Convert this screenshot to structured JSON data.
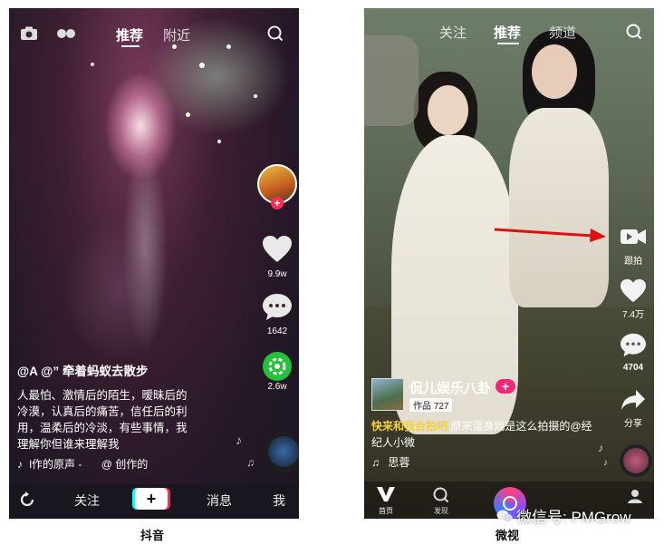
{
  "douyin": {
    "top_nav": {
      "recommend": "推荐",
      "nearby": "附近"
    },
    "side": {
      "likes": "9.9w",
      "comments": "1642",
      "shares": "2.6w"
    },
    "author_line": "@A @” 牵着蚂蚁去散步",
    "desc_lines": [
      "人最怕、激情后的陌生，暧昧后的",
      "冷漠，认真后的痛苦，信任后的利",
      "用，温柔后的冷淡，有些事情，我",
      "理解你但谁来理解我"
    ],
    "music_left": "l作的原声 -",
    "music_right": "@  创作的",
    "bottom_nav": {
      "follow": "关注",
      "plus": "+",
      "messages": "消息",
      "me": "我"
    },
    "caption": "抖音"
  },
  "weishi": {
    "top_nav": {
      "follow": "关注",
      "recommend": "推荐",
      "channel": "频道"
    },
    "side": {
      "shoot_label": "跟拍",
      "likes": "7.4万",
      "comments": "4704",
      "share_label": "分享"
    },
    "author": {
      "name": "侃儿娱乐八卦",
      "works": "作品 727",
      "plus": "+"
    },
    "desc_highlight": "快来和我合拍吧",
    "desc_rest": " 原来湿身戏是这么拍摄的@经",
    "desc_line2": "纪人小微",
    "music": "思蓉",
    "bottom_nav": {
      "home": "首页",
      "discover": "发现"
    },
    "caption": "微视"
  },
  "watermark": "微信号: PMGrow",
  "colors": {
    "red": "#fe2c55",
    "green": "#22c33a",
    "highlight_yellow": "#f5d13b",
    "pink": "#f0287a"
  }
}
